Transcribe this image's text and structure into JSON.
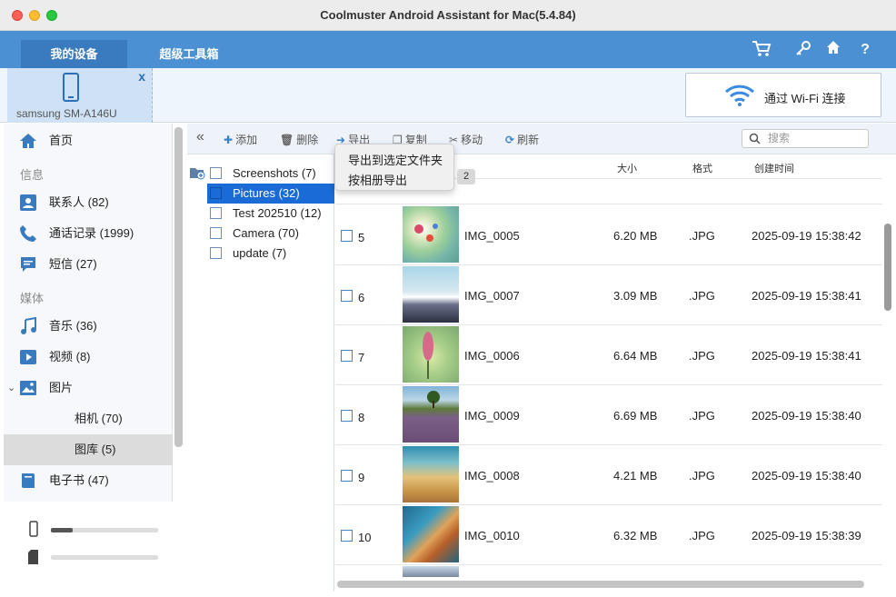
{
  "window": {
    "title": "Coolmuster Android Assistant for Mac(5.4.84)"
  },
  "topnav": {
    "tabs": [
      "我的设备",
      "超级工具箱"
    ]
  },
  "device": {
    "name": "samsung SM-A146U",
    "close": "x"
  },
  "wifi": {
    "label": "通过 Wi-Fi 连接"
  },
  "sidebar": {
    "home": "首页",
    "section_info": "信息",
    "contacts": "联系人 (82)",
    "calls": "通话记录 (1999)",
    "sms": "短信 (27)",
    "section_media": "媒体",
    "music": "音乐 (36)",
    "video": "视频 (8)",
    "photos": "图片",
    "camera": "相机 (70)",
    "gallery": "图库 (5)",
    "ebooks": "电子书 (47)"
  },
  "toolbar": {
    "add": "添加",
    "delete": "删除",
    "export": "导出",
    "copy": "复制",
    "move": "移动",
    "refresh": "刷新",
    "search_placeholder": "搜索"
  },
  "tree": [
    {
      "label": "Screenshots (7)"
    },
    {
      "label": "Pictures (32)"
    },
    {
      "label": "Test 202510 (12)"
    },
    {
      "label": "Camera (70)"
    },
    {
      "label": "update (7)"
    }
  ],
  "menu": {
    "items": [
      "导出到选定文件夹",
      "按相册导出"
    ],
    "badge": "2"
  },
  "table": {
    "headers": {
      "size": "大小",
      "format": "格式",
      "created": "创建时间"
    },
    "rows": [
      {
        "num": "5",
        "name": "IMG_0005",
        "size": "6.20 MB",
        "format": ".JPG",
        "date": "2025-09-19 15:38:42"
      },
      {
        "num": "6",
        "name": "IMG_0007",
        "size": "3.09 MB",
        "format": ".JPG",
        "date": "2025-09-19 15:38:41"
      },
      {
        "num": "7",
        "name": "IMG_0006",
        "size": "6.64 MB",
        "format": ".JPG",
        "date": "2025-09-19 15:38:41"
      },
      {
        "num": "8",
        "name": "IMG_0009",
        "size": "6.69 MB",
        "format": ".JPG",
        "date": "2025-09-19 15:38:40"
      },
      {
        "num": "9",
        "name": "IMG_0008",
        "size": "4.21 MB",
        "format": ".JPG",
        "date": "2025-09-19 15:38:40"
      },
      {
        "num": "10",
        "name": "IMG_0010",
        "size": "6.32 MB",
        "format": ".JPG",
        "date": "2025-09-19 15:38:39"
      }
    ]
  },
  "storage": {
    "phone_fill": 0.2,
    "sd_fill": 0.0
  }
}
